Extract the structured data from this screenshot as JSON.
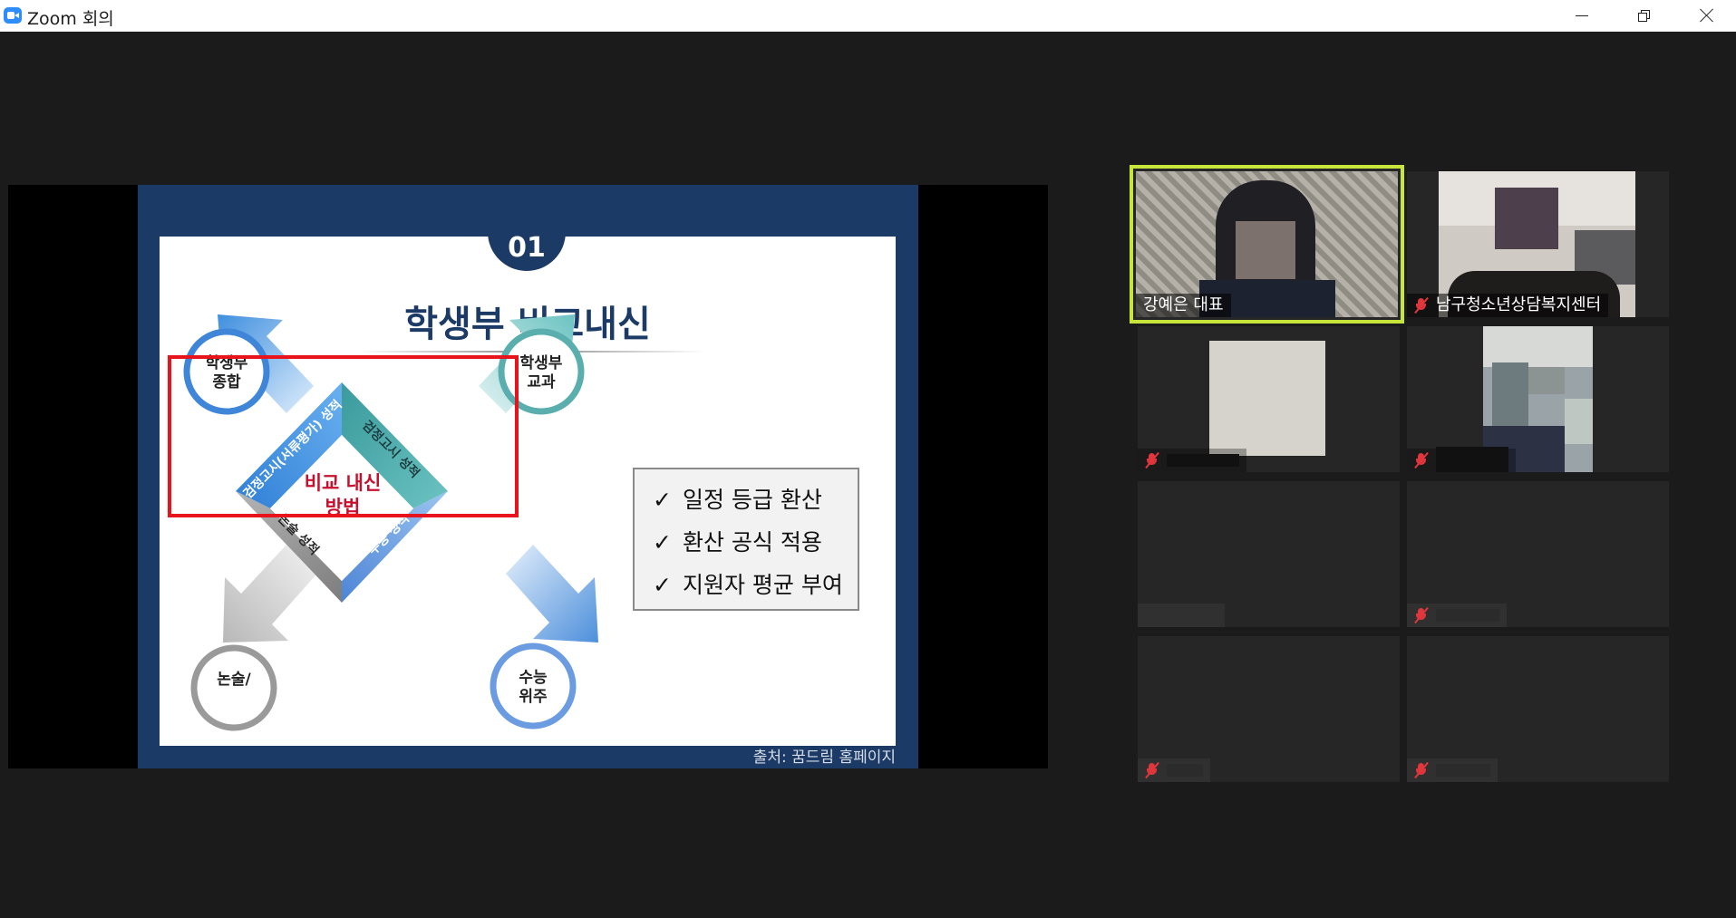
{
  "window": {
    "title": "Zoom 회의",
    "controls": {
      "minimize_icon": "minimize-icon",
      "restore_icon": "restore-icon",
      "close_icon": "close-icon"
    }
  },
  "shared_screen": {
    "slide": {
      "number": "01",
      "title": "학생부 비교내신",
      "diagram": {
        "corner_labels": {
          "top_left": [
            "학생부",
            "종합"
          ],
          "top_right": [
            "학생부",
            "교과"
          ],
          "bottom_left": [
            "논술/",
            ""
          ],
          "bottom_right": [
            "수능",
            "위주"
          ]
        },
        "side_labels": {
          "upper_left": "검정고시(서류평가) 성적",
          "upper_right": "검정고시 성적",
          "lower_left": "논술 성적",
          "lower_right": "수능 성적"
        },
        "center_text": [
          "비교 내신",
          "방법"
        ]
      },
      "checklist": [
        "일정 등급 환산",
        "환산 공식 적용",
        "지원자 평균 부여"
      ],
      "source": "출처: 꿈드림 홈페이지"
    },
    "colors": {
      "slide_frame": "#1c3a66",
      "highlight_box": "#e8141c"
    }
  },
  "gallery": {
    "participants": [
      {
        "name": "강예은 대표",
        "muted": false,
        "active_speaker": true
      },
      {
        "name": "남구청소년상담복지센터",
        "muted": true,
        "active_speaker": false
      },
      {
        "name": "",
        "muted": true,
        "active_speaker": false
      },
      {
        "name": "",
        "muted": true,
        "active_speaker": false
      },
      {
        "name": "",
        "muted": false,
        "active_speaker": false
      },
      {
        "name": "",
        "muted": true,
        "active_speaker": false
      },
      {
        "name": "",
        "muted": true,
        "active_speaker": false
      },
      {
        "name": "",
        "muted": true,
        "active_speaker": false
      }
    ],
    "colors": {
      "active_border": "#c7e53b",
      "mute_icon": "#e0363c"
    }
  }
}
